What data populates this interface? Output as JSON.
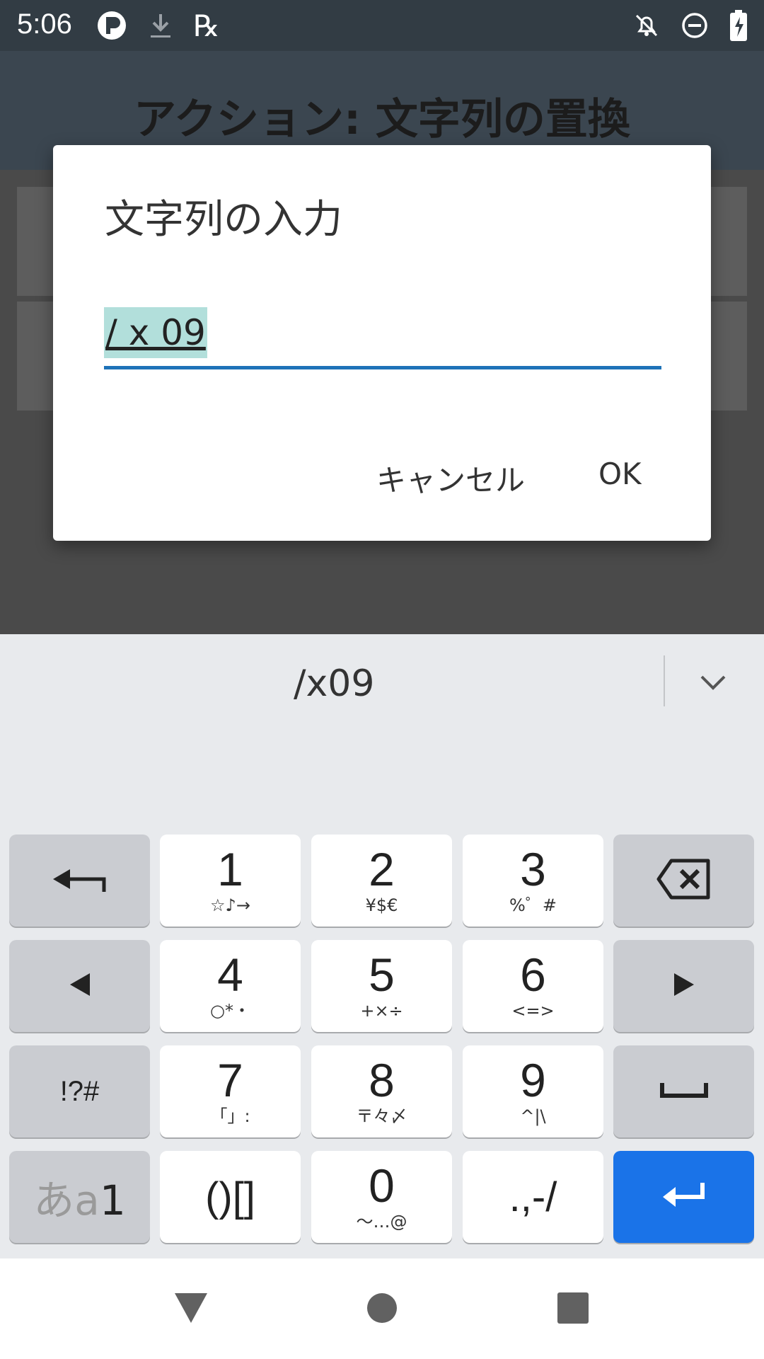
{
  "status_bar": {
    "time": "5:06",
    "icons": [
      "app-circle-icon",
      "download-icon",
      "rx-icon",
      "notifications-off-icon",
      "do-not-disturb-icon",
      "battery-charging-icon"
    ],
    "rx_text": "℞"
  },
  "app_bar": {
    "title": "アクション: 文字列の置換"
  },
  "dialog": {
    "title": "文字列の入力",
    "input_value": "/ x 09",
    "cancel_label": "キャンセル",
    "ok_label": "OK"
  },
  "keyboard": {
    "candidate": "/x09",
    "keys": {
      "k1": {
        "main": "1",
        "sub": "☆♪→"
      },
      "k2": {
        "main": "2",
        "sub": "¥$€"
      },
      "k3": {
        "main": "3",
        "sub": "%゜#"
      },
      "k4": {
        "main": "4",
        "sub": "○*・"
      },
      "k5": {
        "main": "5",
        "sub": "+×÷"
      },
      "k6": {
        "main": "6",
        "sub": "<=>"
      },
      "k7": {
        "main": "7",
        "sub": "「」:"
      },
      "k8": {
        "main": "8",
        "sub": "〒々〆"
      },
      "k9": {
        "main": "9",
        "sub": "^|\\"
      },
      "k0": {
        "main": "0",
        "sub": "〜…@"
      },
      "symbols": "!?#",
      "brackets": "()[]",
      "punct": ".,-/",
      "mode_kana": "あa",
      "mode_num": "1"
    },
    "accent_color": "#1a73e8"
  },
  "nav_bar": {
    "buttons": [
      "back-icon",
      "home-icon",
      "recents-icon"
    ]
  }
}
